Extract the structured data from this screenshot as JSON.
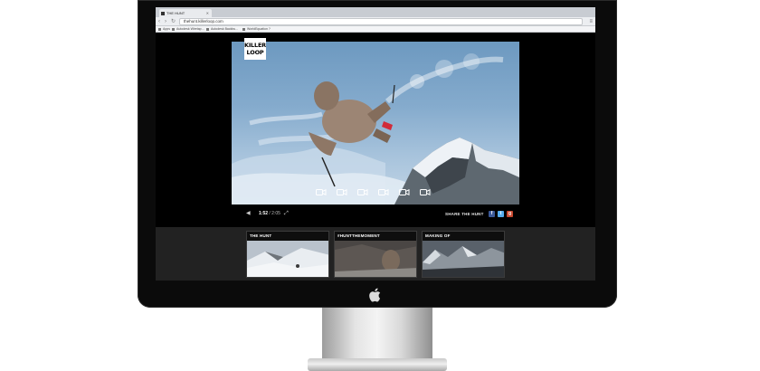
{
  "device": {
    "logo_glyph": ""
  },
  "browser": {
    "tab_title": "THE HUNT",
    "url": "thehunt.killerloop.com",
    "bookmarks": [
      {
        "label": "Apps"
      },
      {
        "label": "Autodesk Wiretap..."
      },
      {
        "label": "Autodesk Backbu..."
      },
      {
        "label": "WorldEquation ?"
      }
    ]
  },
  "site": {
    "logo_line1": "KILLER",
    "logo_line2": "LOOP",
    "player": {
      "counter_current": "1:52",
      "counter_total": "/ 2:05",
      "share_label": "SHARE THE HUNT",
      "social": [
        {
          "name": "facebook",
          "glyph": "f",
          "color": "#3b5998"
        },
        {
          "name": "twitter",
          "glyph": "t",
          "color": "#55acee"
        },
        {
          "name": "google-plus",
          "glyph": "g",
          "color": "#c7482f"
        }
      ],
      "camera_icon_count": 6
    },
    "thumbnails": [
      {
        "title": "THE HUNT"
      },
      {
        "title": "#HUNTTHEMOMENT"
      },
      {
        "title": "MAKING OF"
      }
    ]
  }
}
